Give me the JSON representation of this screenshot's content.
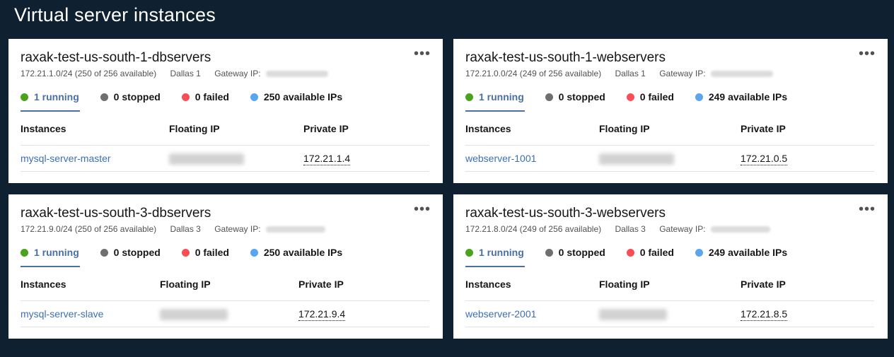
{
  "page": {
    "title": "Virtual server instances"
  },
  "cards": [
    {
      "title": "raxak-test-us-south-1-dbservers",
      "subnet": "172.21.1.0/24 (250 of 256 available)",
      "location": "Dallas 1",
      "gateway_label": "Gateway IP:",
      "status": {
        "running": "1 running",
        "stopped": "0 stopped",
        "failed": "0 failed",
        "available": "250 available IPs"
      },
      "columns": {
        "instances": "Instances",
        "floating": "Floating IP",
        "private": "Private IP"
      },
      "row": {
        "instance": "mysql-server-master",
        "private_ip": "172.21.1.4"
      }
    },
    {
      "title": "raxak-test-us-south-1-webservers",
      "subnet": "172.21.0.0/24 (249 of 256 available)",
      "location": "Dallas 1",
      "gateway_label": "Gateway IP:",
      "status": {
        "running": "1 running",
        "stopped": "0 stopped",
        "failed": "0 failed",
        "available": "249 available IPs"
      },
      "columns": {
        "instances": "Instances",
        "floating": "Floating IP",
        "private": "Private IP"
      },
      "row": {
        "instance": "webserver-1001",
        "private_ip": "172.21.0.5"
      }
    },
    {
      "title": "raxak-test-us-south-3-dbservers",
      "subnet": "172.21.9.0/24 (250 of 256 available)",
      "location": "Dallas 3",
      "gateway_label": "Gateway IP:",
      "status": {
        "running": "1 running",
        "stopped": "0 stopped",
        "failed": "0 failed",
        "available": "250 available IPs"
      },
      "columns": {
        "instances": "Instances",
        "floating": "Floating IP",
        "private": "Private IP"
      },
      "row": {
        "instance": "mysql-server-slave",
        "private_ip": "172.21.9.4"
      }
    },
    {
      "title": "raxak-test-us-south-3-webservers",
      "subnet": "172.21.8.0/24 (249 of 256 available)",
      "location": "Dallas 3",
      "gateway_label": "Gateway IP:",
      "status": {
        "running": "1 running",
        "stopped": "0 stopped",
        "failed": "0 failed",
        "available": "249 available IPs"
      },
      "columns": {
        "instances": "Instances",
        "floating": "Floating IP",
        "private": "Private IP"
      },
      "row": {
        "instance": "webserver-2001",
        "private_ip": "172.21.8.5"
      }
    }
  ],
  "icons": {
    "overflow": "overflow-menu-icon"
  },
  "colors": {
    "running": "#42be65",
    "stopped": "#6f6f6f",
    "failed": "#fa4d56",
    "available": "#4589ff",
    "link": "#3d6fb6",
    "background": "#0f2131"
  }
}
